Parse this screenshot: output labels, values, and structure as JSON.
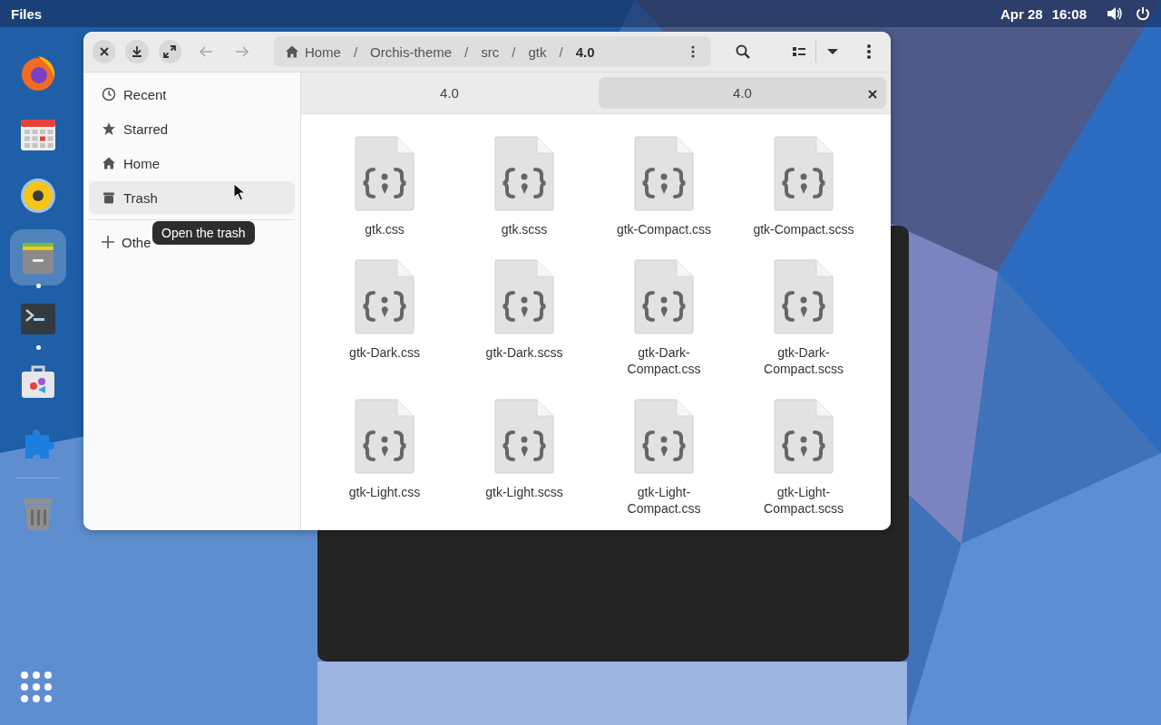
{
  "top_bar": {
    "app_name": "Files",
    "date": "Apr 28",
    "time": "16:08"
  },
  "dock": {
    "apps": [
      {
        "kind": "browser",
        "running": false,
        "selected": false
      },
      {
        "kind": "calendar",
        "running": false,
        "selected": false
      },
      {
        "kind": "speaker",
        "running": false,
        "selected": false
      },
      {
        "kind": "files",
        "running": true,
        "selected": true
      },
      {
        "kind": "terminal",
        "running": true,
        "selected": false
      },
      {
        "kind": "software",
        "running": false,
        "selected": false
      },
      {
        "kind": "extensions",
        "running": false,
        "selected": false
      },
      {
        "kind": "trash",
        "running": false,
        "selected": false
      }
    ]
  },
  "window": {
    "path": [
      {
        "label": "Home",
        "kind": "home",
        "current": false
      },
      {
        "separator": "/",
        "label": "Orchis-theme",
        "kind": "folder",
        "current": false
      },
      {
        "separator": "/",
        "label": "src",
        "kind": "folder",
        "current": false
      },
      {
        "separator": "/",
        "label": "gtk",
        "kind": "folder",
        "current": false
      },
      {
        "separator": "/",
        "label": "4.0",
        "kind": "folder",
        "current": true
      }
    ],
    "tabs": [
      {
        "label": "4.0",
        "selected": false
      },
      {
        "label": "4.0",
        "selected": true
      }
    ],
    "sidebar": {
      "items": [
        {
          "label": "Recent",
          "kind": "recent",
          "highlighted": false
        },
        {
          "label": "Starred",
          "kind": "starred",
          "highlighted": false
        },
        {
          "label": "Home",
          "kind": "home",
          "highlighted": false
        },
        {
          "label": "Trash",
          "kind": "trash",
          "highlighted": true
        }
      ],
      "other": {
        "label": "Othe"
      }
    },
    "files": [
      {
        "name": "gtk.css"
      },
      {
        "name": "gtk.scss"
      },
      {
        "name": "gtk-Compact.css"
      },
      {
        "name": "gtk-Compact.scss"
      },
      {
        "name": "gtk-Dark.css"
      },
      {
        "name": "gtk-Dark.scss"
      },
      {
        "name": "gtk-Dark-Compact.css"
      },
      {
        "name": "gtk-Dark-Compact.scss"
      },
      {
        "name": "gtk-Light.css"
      },
      {
        "name": "gtk-Light.scss"
      },
      {
        "name": "gtk-Light-Compact.css"
      },
      {
        "name": "gtk-Light-Compact.scss"
      }
    ],
    "tooltip": "Open the trash"
  }
}
